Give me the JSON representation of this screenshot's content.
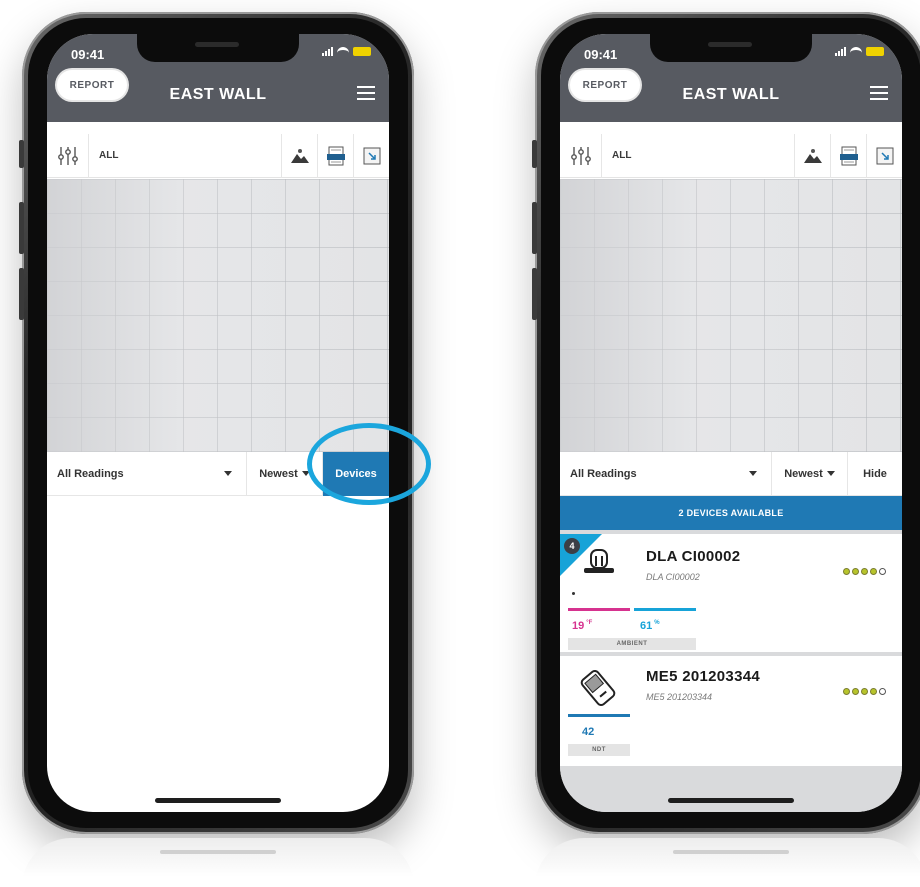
{
  "status": {
    "time": "09:41"
  },
  "header": {
    "report_label": "REPORT",
    "title": "EAST WALL"
  },
  "toolbar": {
    "filter_label": "ALL",
    "csv_label": "CSV"
  },
  "filter_bar": {
    "readings_label": "All Readings",
    "sort_label": "Newest",
    "devices_label": "Devices",
    "hide_label": "Hide"
  },
  "devices_panel": {
    "banner": "2 DEVICES AVAILABLE",
    "devices": [
      {
        "badge": "4",
        "title": "DLA CI00002",
        "subtitle": "DLA CI00002",
        "icon": "hat-sensor-icon",
        "signal_level": 4,
        "signal_max": 5,
        "readings": [
          {
            "value": "19",
            "unit": "°F",
            "color": "#d6338f"
          },
          {
            "value": "61",
            "unit": "%",
            "color": "#17a3d8"
          }
        ],
        "mode": "AMBIENT"
      },
      {
        "title": "ME5 201203344",
        "subtitle": "ME5 201203344",
        "icon": "meter-icon",
        "signal_level": 4,
        "signal_max": 5,
        "readings": [
          {
            "value": "42",
            "unit": "",
            "color": "#1f79b4"
          }
        ],
        "mode": "NDT"
      }
    ]
  },
  "colors": {
    "header_bg": "#575a61",
    "accent_blue": "#1f79b4",
    "highlight_ring": "#1ba6dd",
    "signal_dot": "#b7c42b"
  }
}
